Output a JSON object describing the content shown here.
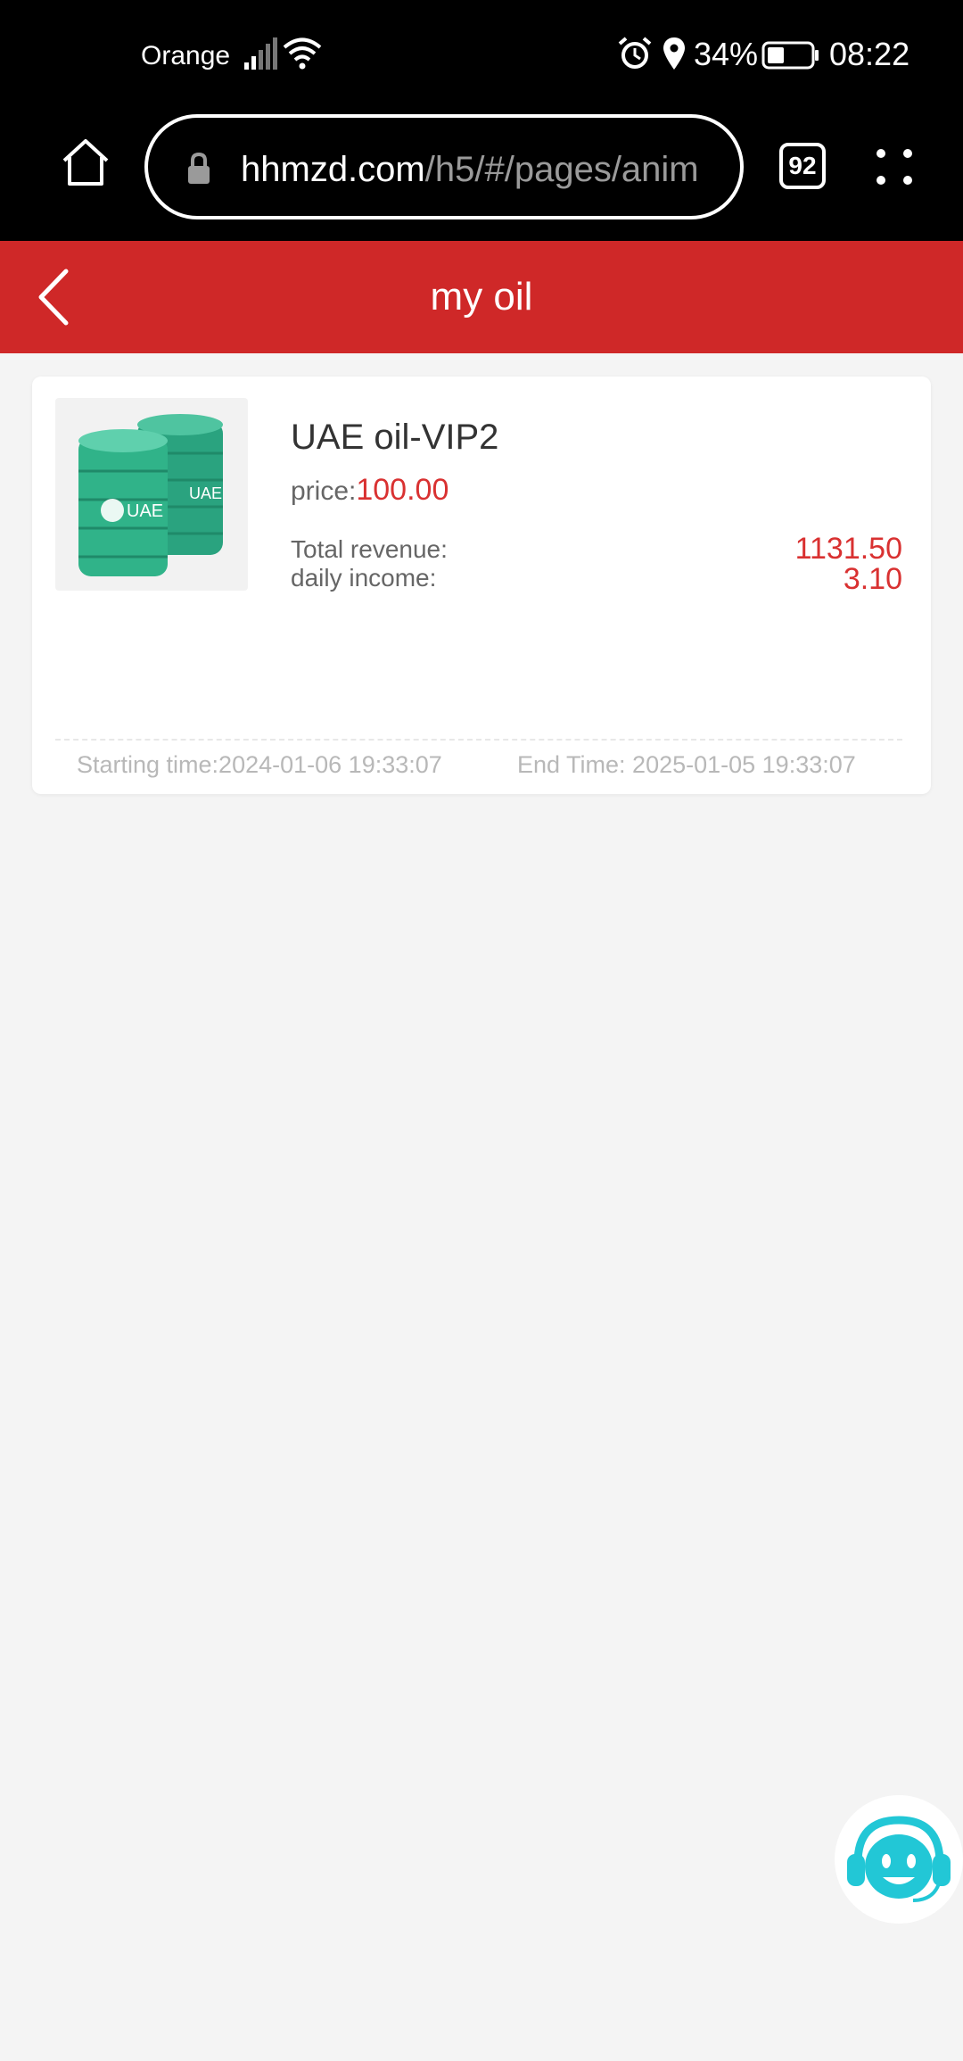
{
  "status_bar": {
    "carrier": "Orange",
    "battery_percent": "34%",
    "time": "08:22"
  },
  "browser": {
    "url_domain": "hhmzd.com",
    "url_path": "/h5/#/pages/anim",
    "tab_count": "92"
  },
  "header": {
    "title": "my oil"
  },
  "order": {
    "product_name": "UAE oil-VIP2",
    "price_label": "price:",
    "price_value": "100.00",
    "total_revenue_label": "Total revenue:",
    "total_revenue_value": "1131.50",
    "daily_income_label": "daily income:",
    "daily_income_value": "3.10",
    "start_time": "Starting time:2024-01-06 19:33:07",
    "end_time": "End Time: 2025-01-05 19:33:07",
    "barrel_label": "UAE"
  },
  "colors": {
    "header_red": "#cf2828",
    "value_red": "#d93131",
    "barrel_green": "#2aa37f",
    "support_cyan": "#22c7d6"
  }
}
